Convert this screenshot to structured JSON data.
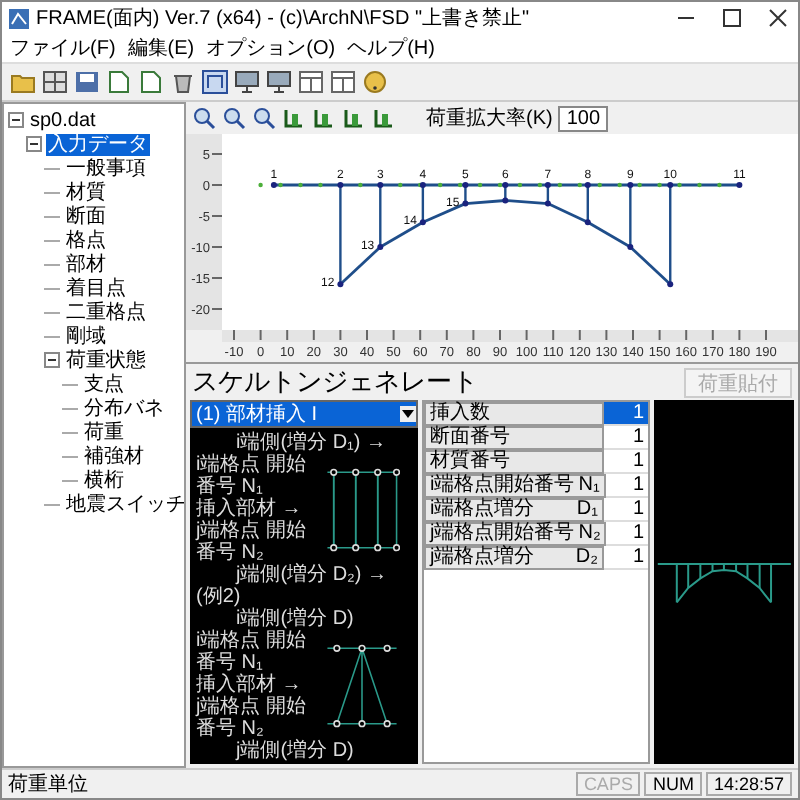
{
  "window": {
    "title": "FRAME(面内) Ver.7 (x64) - (c)\\ArchN\\FSD \"上書き禁止\""
  },
  "menu": [
    {
      "label": "ファイル(F)"
    },
    {
      "label": "編集(E)"
    },
    {
      "label": "オプション(O)"
    },
    {
      "label": "ヘルプ(H)"
    }
  ],
  "tree": {
    "label": "sp0.dat",
    "selected": false,
    "expanded": true,
    "children": [
      {
        "label": "入力データ",
        "selected": true,
        "expanded": true,
        "children": [
          {
            "label": "一般事項",
            "selected": false
          },
          {
            "label": "材質",
            "selected": false
          },
          {
            "label": "断面",
            "selected": false
          },
          {
            "label": "格点",
            "selected": false
          },
          {
            "label": "部材",
            "selected": false
          },
          {
            "label": "着目点",
            "selected": false
          },
          {
            "label": "二重格点",
            "selected": false
          },
          {
            "label": "剛域",
            "selected": false
          },
          {
            "label": "荷重状態",
            "selected": false,
            "expanded": true,
            "children": [
              {
                "label": "支点",
                "selected": false
              },
              {
                "label": "分布バネ",
                "selected": false
              },
              {
                "label": "荷重",
                "selected": false
              },
              {
                "label": "補強材",
                "selected": false
              },
              {
                "label": "横桁",
                "selected": false
              }
            ]
          },
          {
            "label": "地震スイッチ",
            "selected": false
          }
        ]
      }
    ]
  },
  "view": {
    "scale_label": "荷重拡大率(K)",
    "scale_value": "100",
    "x_ticks": [
      "-10",
      "0",
      "10",
      "20",
      "30",
      "40",
      "50",
      "60",
      "70",
      "80",
      "90",
      "100",
      "110",
      "120",
      "130",
      "140",
      "150",
      "160",
      "170",
      "180",
      "190"
    ],
    "y_ticks": [
      "5",
      "0",
      "-5",
      "-10",
      "-15",
      "-20"
    ],
    "deck_nodes": [
      "1",
      "2",
      "3",
      "4",
      "5",
      "6",
      "7",
      "8",
      "9",
      "10",
      "11"
    ],
    "arch_nodes": [
      "12",
      "13",
      "14",
      "15"
    ]
  },
  "generator": {
    "title": "スケルトンジェネレート",
    "paste_button": {
      "label": "荷重貼付",
      "disabled": true
    },
    "mode": "(1) 部材挿入 I",
    "examples": [
      {
        "kind": "frame",
        "top": "i端側(増分 D₁) →",
        "labels": [
          "i端格点 開始番号 N₁",
          "挿入部材 →",
          "j端格点 開始番号 N₂"
        ],
        "bottom": "j端側(増分 D₂) →"
      },
      {
        "kind": "truss",
        "title": "(例2)",
        "top": "i端側(増分 D)",
        "labels": [
          "i端格点 開始番号 N₁",
          "挿入部材 →",
          "j端格点 開始番号 N₂"
        ],
        "bottom": "j端側(増分 D)"
      }
    ],
    "params": [
      {
        "label": "挿入数",
        "value": "1",
        "selected": true
      },
      {
        "label": "断面番号",
        "value": "1",
        "selected": false
      },
      {
        "label": "材質番号",
        "value": "1",
        "selected": false
      },
      {
        "label": "i端格点開始番号",
        "unit": "N₁",
        "value": "1",
        "selected": false
      },
      {
        "label": "i端格点増分",
        "unit": "D₁",
        "value": "1",
        "selected": false
      },
      {
        "label": "j端格点開始番号",
        "unit": "N₂",
        "value": "1",
        "selected": false
      },
      {
        "label": "j端格点増分",
        "unit": "D₂",
        "value": "1",
        "selected": false
      }
    ]
  },
  "status_bar": {
    "message": "荷重単位",
    "indicators": [
      {
        "label": "CAPS",
        "active": false
      },
      {
        "label": "NUM",
        "active": true
      },
      {
        "label": "14:28:57",
        "active": true
      }
    ]
  }
}
